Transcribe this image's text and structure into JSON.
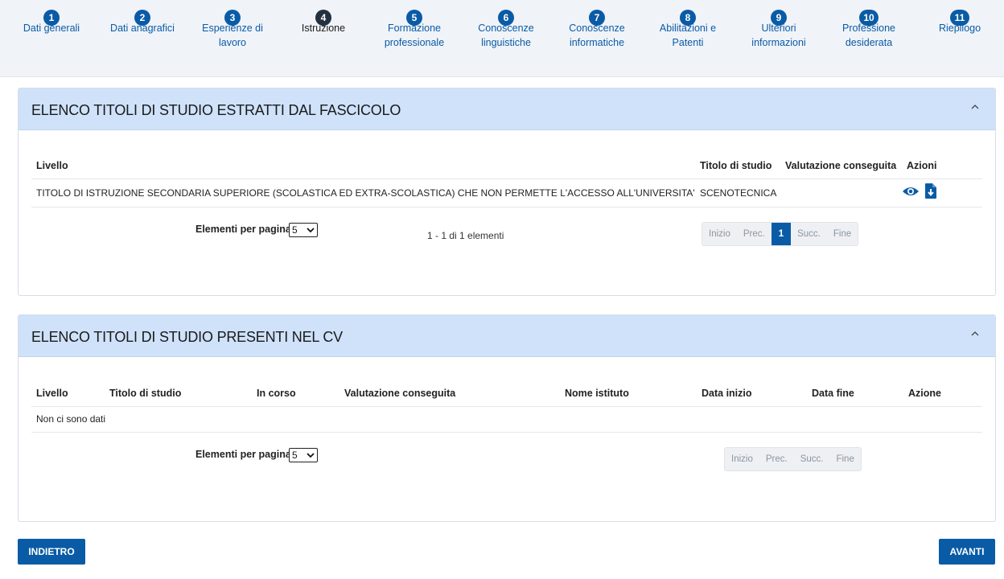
{
  "steps": [
    {
      "num": "1",
      "label": "Dati generali"
    },
    {
      "num": "2",
      "label": "Dati anagrafici"
    },
    {
      "num": "3",
      "label": "Esperienze di\nlavoro"
    },
    {
      "num": "4",
      "label": "Istruzione"
    },
    {
      "num": "5",
      "label": "Formazione\nprofessionale"
    },
    {
      "num": "6",
      "label": "Conoscenze\nlinguistiche"
    },
    {
      "num": "7",
      "label": "Conoscenze\ninformatiche"
    },
    {
      "num": "8",
      "label": "Abilitazioni e\nPatenti"
    },
    {
      "num": "9",
      "label": "Ulteriori\ninformazioni"
    },
    {
      "num": "10",
      "label": "Professione\ndesiderata"
    },
    {
      "num": "11",
      "label": "Riepilogo"
    }
  ],
  "active_step": "4",
  "panel1": {
    "title": "ELENCO TITOLI DI STUDIO ESTRATTI DAL FASCICOLO",
    "headers": {
      "livello": "Livello",
      "titolo": "Titolo di studio",
      "valutazione": "Valutazione conseguita",
      "azioni": "Azioni"
    },
    "rows": [
      {
        "livello": "TITOLO DI ISTRUZIONE SECONDARIA SUPERIORE (SCOLASTICA ED EXTRA-SCOLASTICA) CHE NON PERMETTE L'ACCESSO ALL'UNIVERSITA'",
        "titolo": "SCENOTECNICA",
        "valutazione": ""
      }
    ],
    "per_page_label": "Elementi per pagina",
    "per_page_value": "5",
    "range_text": "1 - 1 di 1 elementi",
    "pager": {
      "first": "Inizio",
      "prev": "Prec.",
      "current": "1",
      "next": "Succ.",
      "last": "Fine"
    }
  },
  "panel2": {
    "title": "ELENCO TITOLI DI STUDIO PRESENTI NEL CV",
    "headers": {
      "livello": "Livello",
      "titolo": "Titolo di studio",
      "in_corso": "In corso",
      "valutazione": "Valutazione conseguita",
      "istituto": "Nome istituto",
      "data_inizio": "Data inizio",
      "data_fine": "Data fine",
      "azione": "Azione"
    },
    "empty_text": "Non ci sono dati",
    "per_page_label": "Elementi per pagina",
    "per_page_value": "5",
    "pager": {
      "first": "Inizio",
      "prev": "Prec.",
      "next": "Succ.",
      "last": "Fine"
    }
  },
  "buttons": {
    "back": "INDIETRO",
    "next": "AVANTI"
  },
  "colors": {
    "primary": "#0a5ba6",
    "active_step": "#22303f",
    "panel_header": "#cfe2fa"
  }
}
